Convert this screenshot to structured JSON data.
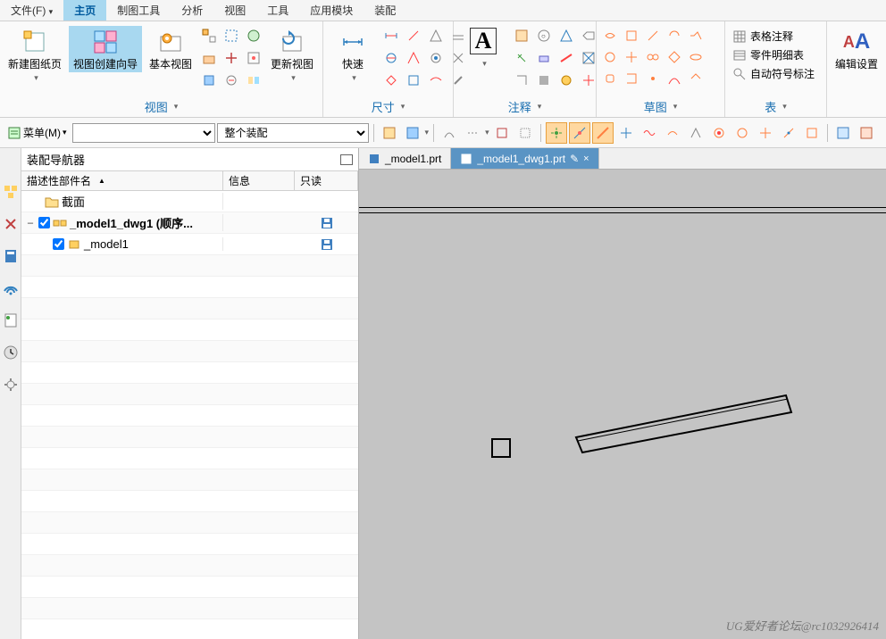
{
  "menubar": {
    "file": "文件(F)",
    "home": "主页",
    "drawing_tools": "制图工具",
    "analysis": "分析",
    "view": "视图",
    "tools": "工具",
    "app_modules": "应用模块",
    "assembly": "装配"
  },
  "ribbon": {
    "group_view_label": "视图",
    "group_dimension_label": "尺寸",
    "group_annotation_label": "注释",
    "group_sketch_label": "草图",
    "group_table_label": "表",
    "new_sheet": "新建图纸页",
    "view_wizard": "视图创建向导",
    "base_view": "基本视图",
    "update_view": "更新视图",
    "quick": "快速",
    "annotation_big": "A",
    "table_annotation": "表格注释",
    "parts_list": "零件明细表",
    "auto_balloon": "自动符号标注",
    "edit_settings": "编辑设置"
  },
  "toolbar": {
    "menu_btn": "菜单(M)",
    "combo2": "整个装配"
  },
  "panel": {
    "title": "装配导航器",
    "col1": "描述性部件名",
    "col2": "信息",
    "col3": "只读",
    "tree": {
      "sections": "截面",
      "model1_dwg": "_model1_dwg1  (顺序...",
      "model1": "_model1"
    }
  },
  "tabs": {
    "tab1": "_model1.prt",
    "tab2": "_model1_dwg1.prt"
  },
  "watermark": "UG爱好者论坛@rc1032926414"
}
